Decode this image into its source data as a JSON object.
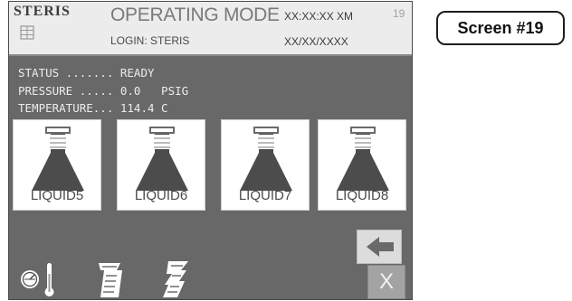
{
  "header": {
    "brand": "STERIS",
    "title": "OPERATING MODE",
    "login": "LOGIN: STERIS",
    "time": "XX:XX:XX XM",
    "date": "XX/XX/XXXX",
    "screen_number": "19"
  },
  "status": {
    "status_line": "STATUS ....... READY",
    "pressure_line": "PRESSURE ..... 0.0   PSIG",
    "temperature_line": "TEMPERATURE... 114.4 C"
  },
  "cycles": [
    {
      "label": "LIQUID5",
      "icon": "flask-icon"
    },
    {
      "label": "LIQUID6",
      "icon": "flask-icon"
    },
    {
      "label": "LIQUID7",
      "icon": "flask-icon"
    },
    {
      "label": "LIQUID8",
      "icon": "flask-icon"
    }
  ],
  "controls": {
    "back_icon": "left-arrow-icon",
    "close_label": "X",
    "bottom_icons": [
      "gauge-thermometer-icon",
      "printer-paper-icon",
      "paper-feed-icon"
    ]
  },
  "callout": {
    "label": "Screen #19"
  },
  "colors": {
    "panel_bg": "#686868",
    "header_bg": "#ececec",
    "button_bg": "#ffffff",
    "close_bg": "#a3a3a3",
    "status_text": "#ececec"
  }
}
